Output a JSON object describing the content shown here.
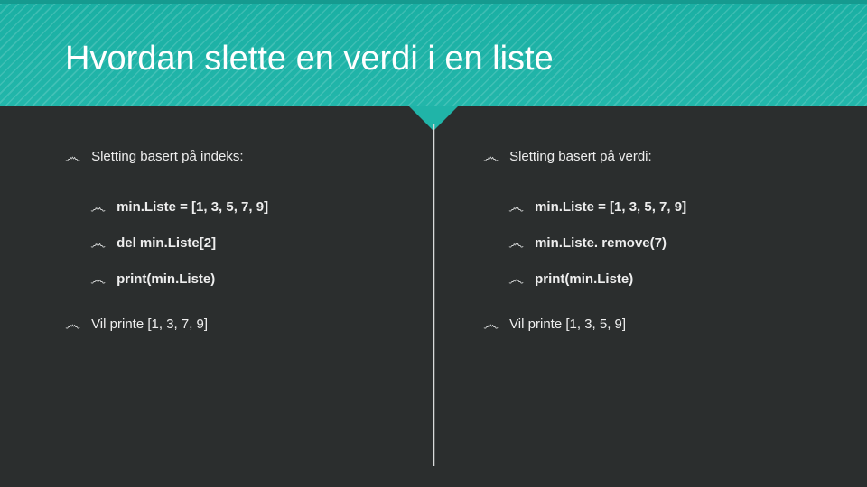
{
  "title": "Hvordan slette en verdi i en liste",
  "left": {
    "heading": "Sletting basert på indeks:",
    "code": [
      "min.Liste = [1, 3, 5, 7, 9]",
      "del min.Liste[2]",
      "print(min.Liste)"
    ],
    "result": "Vil printe [1, 3, 7, 9]"
  },
  "right": {
    "heading": "Sletting basert på verdi:",
    "code": [
      "min.Liste = [1, 3, 5, 7, 9]",
      "min.Liste. remove(7)",
      "print(min.Liste)"
    ],
    "result": "Vil printe [1, 3, 5, 9]"
  },
  "bullet": "෴"
}
